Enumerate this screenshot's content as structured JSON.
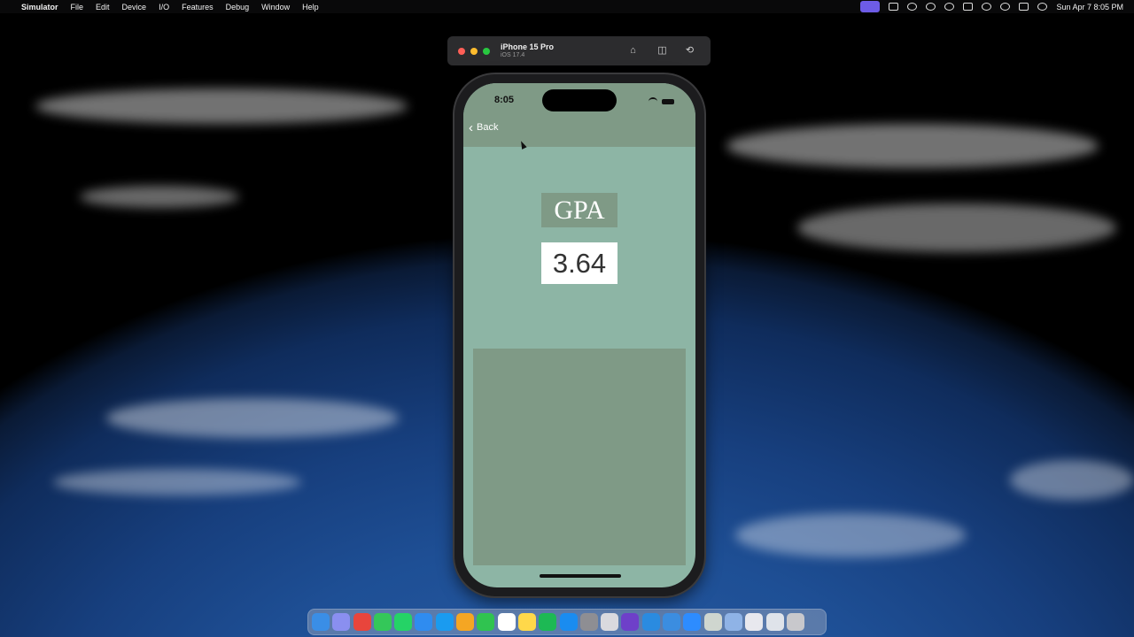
{
  "menubar": {
    "app_name": "Simulator",
    "menus": [
      "File",
      "Edit",
      "Device",
      "I/O",
      "Features",
      "Debug",
      "Window",
      "Help"
    ],
    "clock": "Sun Apr 7  8:05 PM"
  },
  "simulator": {
    "device_name": "iPhone 15 Pro",
    "os_version": "iOS 17.4"
  },
  "phone": {
    "status_time": "8:05",
    "back_label": "Back",
    "gpa_label": "GPA",
    "gpa_value": "3.64"
  },
  "colors": {
    "nav_bar": "#7f9a86",
    "screen_bg": "#8db5a5",
    "panel": "#7f9a86"
  },
  "dock": {
    "apps": [
      {
        "icon": "finder-icon",
        "color": "#3a8ee6"
      },
      {
        "icon": "launchpad-icon",
        "color": "#8a8ff0"
      },
      {
        "icon": "chrome-icon",
        "color": "#e8453c"
      },
      {
        "icon": "messages-icon",
        "color": "#34c759"
      },
      {
        "icon": "whatsapp-icon",
        "color": "#25d366"
      },
      {
        "icon": "mail-icon",
        "color": "#2f8cf0"
      },
      {
        "icon": "safari-icon",
        "color": "#1a9bf0"
      },
      {
        "icon": "photos-icon",
        "color": "#f5a623"
      },
      {
        "icon": "facetime-icon",
        "color": "#30c350"
      },
      {
        "icon": "calendar-icon",
        "color": "#ffffff"
      },
      {
        "icon": "notes-icon",
        "color": "#ffd84a"
      },
      {
        "icon": "spotify-icon",
        "color": "#1db954"
      },
      {
        "icon": "app-store-icon",
        "color": "#1a8cf0"
      },
      {
        "icon": "system-settings-icon",
        "color": "#8e8e93"
      },
      {
        "icon": "preview-icon",
        "color": "#d9d9de"
      },
      {
        "icon": "github-icon",
        "color": "#6e40c9"
      },
      {
        "icon": "vscode-icon",
        "color": "#2a8be0"
      },
      {
        "icon": "xcode-icon",
        "color": "#3b8de0"
      },
      {
        "icon": "zoom-icon",
        "color": "#2d8cff"
      },
      {
        "icon": "document-icon",
        "color": "#cfd6cf"
      },
      {
        "icon": "folder-icon",
        "color": "#8fb3e6"
      },
      {
        "icon": "screenshot-icon",
        "color": "#e8e8ee"
      },
      {
        "icon": "window-icon",
        "color": "#dfe3ea"
      },
      {
        "icon": "trash-icon",
        "color": "#c8c8cc"
      }
    ]
  }
}
